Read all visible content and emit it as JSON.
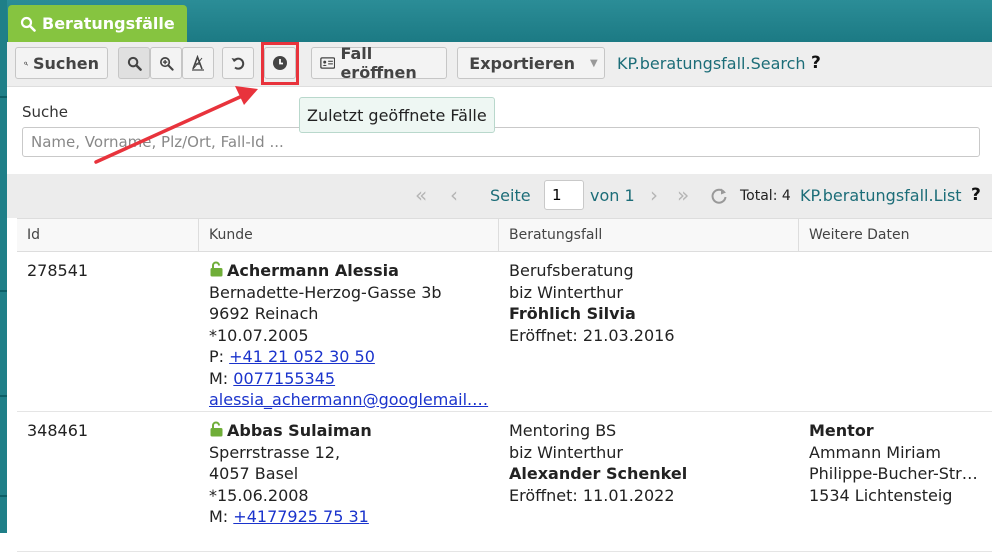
{
  "tab": {
    "label": "Beratungsfälle",
    "icon": "search-icon"
  },
  "toolbar": {
    "search_label": "Suchen",
    "open_case_label": "Fall eröffnen",
    "export_label": "Exportieren",
    "search_link": "KP.beratungsfall.Search",
    "help": "?"
  },
  "search": {
    "label": "Suche",
    "placeholder": "Name, Vorname, Plz/Ort, Fall-Id ..."
  },
  "tooltip": "Zuletzt geöffnete Fälle",
  "pager": {
    "page_label": "Seite",
    "page_value": "1",
    "of_label": "von 1",
    "total_label": "Total: 4",
    "list_link": "KP.beratungsfall.List",
    "help": "?"
  },
  "table": {
    "columns": [
      "Id",
      "Kunde",
      "Beratungsfall",
      "Weitere Daten"
    ],
    "rows": [
      {
        "id": "278541",
        "name": "Achermann Alessia",
        "street": "Bernadette-Herzog-Gasse 3b",
        "city": "9692 Reinach",
        "birth": "*10.07.2005",
        "phone_prefix": "P:",
        "phone": "+41 21 052 30 50",
        "mobile_prefix": "M:",
        "mobile": "0077155345",
        "email": "alessia_achermann@googlemail.…",
        "case_type": "Berufsberatung",
        "location": "biz Winterthur",
        "advisor": "Fröhlich Silvia",
        "opened": "Eröffnet: 21.03.2016"
      },
      {
        "id": "348461",
        "name": "Abbas Sulaiman",
        "street": "Sperrstrasse 12,",
        "city": "4057 Basel",
        "birth": "*15.06.2008",
        "mobile_prefix": "M:",
        "mobile": "+4177925 75 31",
        "case_type": "Mentoring BS",
        "location": "biz Winterthur",
        "advisor": "Alexander Schenkel",
        "opened": "Eröffnet: 11.01.2022",
        "extra_title": "Mentor",
        "extra_name": "Ammann Miriam",
        "extra_street": "Philippe-Bucher-Str…",
        "extra_city": "1534 Lichtensteig"
      }
    ]
  },
  "colors": {
    "accent": "#86c440",
    "teal": "#1f7f88",
    "link": "#1c6d78",
    "highlight": "#e8333c"
  }
}
